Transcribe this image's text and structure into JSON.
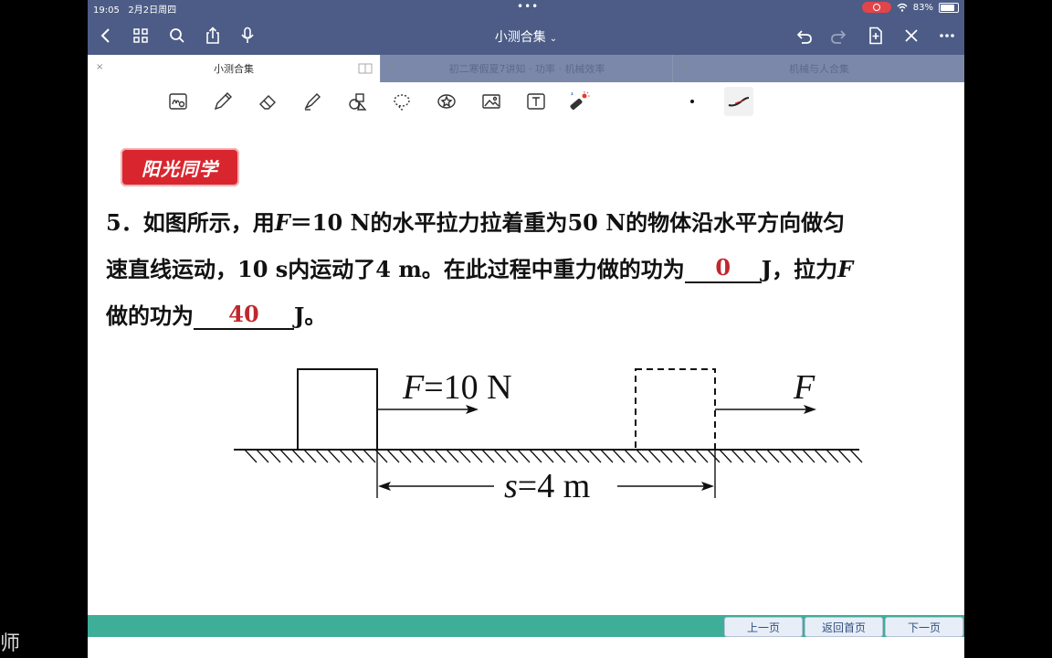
{
  "status": {
    "time": "19:05",
    "date": "2月2日周四",
    "battery": "83%",
    "battery_level": 0.83
  },
  "nav": {
    "title": "小测合集",
    "title_chevron": "⌄"
  },
  "tabs": [
    {
      "label": "小测合集",
      "active": true
    },
    {
      "label": "初二寒假夏7讲知 · 功率 · 机械效率",
      "active": false
    },
    {
      "label": "机械与人合集",
      "active": false
    }
  ],
  "toolbar": {
    "items": [
      "lasso-text-icon",
      "pen-icon",
      "eraser-icon",
      "highlighter-icon",
      "shapes-icon",
      "lasso-icon",
      "sticker-icon",
      "image-icon",
      "textbox-icon",
      "laser-pointer-icon",
      "pen-size-dot",
      "stroke-preview"
    ]
  },
  "content": {
    "logo": "阳光同学",
    "question_line1_a": "5．如图所示，用",
    "question_line1_F": "F",
    "question_line1_b": "＝10 N的水平拉力拉着重为50 N的物体沿水平方向做匀",
    "question_line2_a": "速直线运动，10 s内运动了4 m。在此过程中重力做的功为",
    "answer1": "0",
    "question_line2_b": "J，拉力",
    "question_line2_F": "F",
    "question_line3_a": "做的功为",
    "answer2": "40",
    "question_line3_b": "J。",
    "answer_color": "#c0272d"
  },
  "diagram": {
    "force_label_italic": "F",
    "force_label_rest": "=10 N",
    "force_label2": "F",
    "distance_italic": "s",
    "distance_rest": "=4 m"
  },
  "pager": {
    "prev": "上一页",
    "home": "返回首页",
    "next": "下一页"
  },
  "outside_text": "师"
}
